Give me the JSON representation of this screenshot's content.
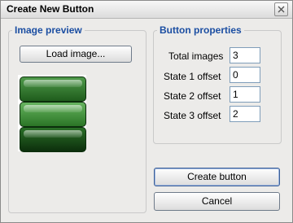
{
  "window": {
    "title": "Create New Button",
    "close_icon": "close-icon"
  },
  "image_preview": {
    "group_label": "Image preview",
    "load_button": "Load image...",
    "states": [
      {
        "name": "state-normal",
        "color_top": "#4f9a4a",
        "color_bottom": "#1f5c1c"
      },
      {
        "name": "state-hover",
        "color_top": "#66b45f",
        "color_bottom": "#2b7526"
      },
      {
        "name": "state-pressed",
        "color_top": "#2a6f27",
        "color_bottom": "#0c2e0c"
      }
    ]
  },
  "properties": {
    "group_label": "Button properties",
    "fields": [
      {
        "label": "Total images",
        "value": "3"
      },
      {
        "label": "State 1 offset",
        "value": "0"
      },
      {
        "label": "State 2 offset",
        "value": "1"
      },
      {
        "label": "State 3 offset",
        "value": "2"
      }
    ]
  },
  "actions": {
    "create": "Create button",
    "cancel": "Cancel"
  },
  "colors": {
    "group_title": "#1b4ea2",
    "window_bg": "#ecebe9"
  }
}
